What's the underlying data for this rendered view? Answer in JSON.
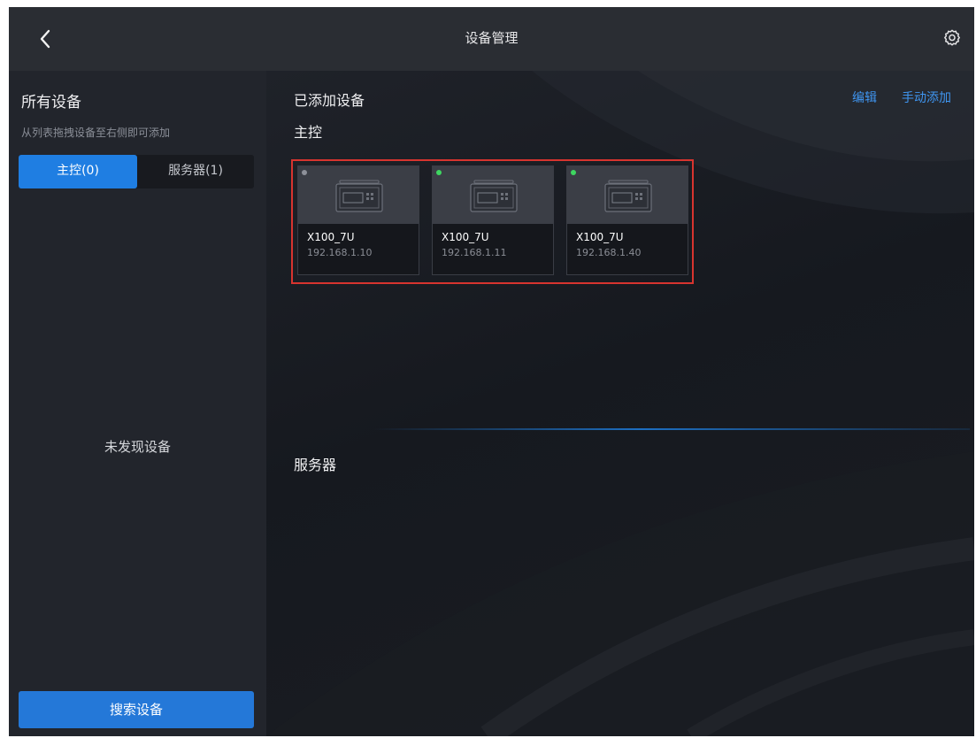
{
  "header": {
    "title": "设备管理",
    "back_icon": "chevron-left-icon",
    "settings_icon": "gear-icon"
  },
  "sidebar": {
    "title": "所有设备",
    "hint": "从列表拖拽设备至右侧即可添加",
    "tabs": [
      {
        "label": "主控(0)",
        "active": true
      },
      {
        "label": "服务器(1)",
        "active": false
      }
    ],
    "empty_text": "未发现设备",
    "search_button": "搜索设备"
  },
  "main": {
    "title": "已添加设备",
    "edit_label": "编辑",
    "manual_add_label": "手动添加",
    "sections": [
      {
        "title": "主控"
      },
      {
        "title": "服务器"
      }
    ],
    "devices": [
      {
        "name": "X100_7U",
        "ip": "192.168.1.10",
        "status": "offline",
        "status_color": "#8d9099"
      },
      {
        "name": "X100_7U",
        "ip": "192.168.1.11",
        "status": "online",
        "status_color": "#3ed660"
      },
      {
        "name": "X100_7U",
        "ip": "192.168.1.40",
        "status": "online",
        "status_color": "#3ed660"
      }
    ]
  },
  "colors": {
    "accent": "#1f7ee2",
    "link": "#3f95f0",
    "highlight_border": "#d7342f",
    "online": "#3ed660",
    "offline": "#8d9099"
  }
}
